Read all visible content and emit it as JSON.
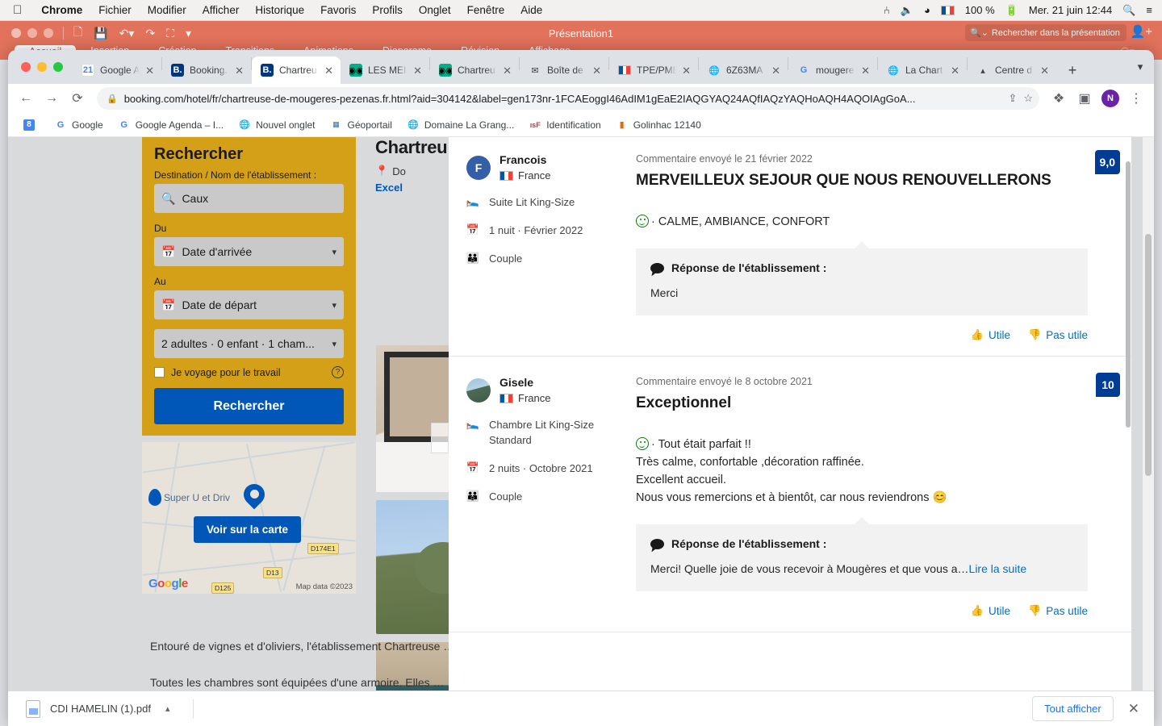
{
  "mac_menu": {
    "apple_icon": "apple-icon",
    "items": [
      "Chrome",
      "Fichier",
      "Modifier",
      "Afficher",
      "Historique",
      "Favoris",
      "Profils",
      "Onglet",
      "Fenêtre",
      "Aide"
    ],
    "status": {
      "bluetooth_icon": "bluetooth-icon",
      "volume_icon": "volume-icon",
      "wifi_icon": "wifi-icon",
      "flag_icon": "french-flag-icon",
      "battery_percent": "100 %",
      "battery_icon": "battery-charging-icon",
      "datetime": "Mer. 21 juin  12:44",
      "search_icon": "spotlight-search-icon",
      "control_center_icon": "control-center-icon"
    }
  },
  "powerpoint": {
    "title": "Présentation1",
    "quick_access": [
      "new-icon",
      "save-icon",
      "undo-icon",
      "redo-icon",
      "present-icon",
      "more-icon"
    ],
    "tabs": [
      "Accueil",
      "Insertion",
      "Création",
      "Transitions",
      "Animations",
      "Diaporama",
      "Révision",
      "Affichage"
    ],
    "active_tab": "Accueil",
    "search_placeholder": "Rechercher dans la présentation",
    "share_icon": "add-user-icon"
  },
  "chrome": {
    "tabs": [
      {
        "label": "Google A",
        "favicon": "google-calendar-icon",
        "active": false
      },
      {
        "label": "Booking.",
        "favicon": "booking-icon",
        "active": false
      },
      {
        "label": "Chartreu",
        "favicon": "booking-icon",
        "active": true
      },
      {
        "label": "LES MEI",
        "favicon": "tripadvisor-icon",
        "active": false
      },
      {
        "label": "Chartreu",
        "favicon": "tripadvisor-icon",
        "active": false
      },
      {
        "label": "Boîte de",
        "favicon": "gmail-icon",
        "active": false
      },
      {
        "label": "TPE/PME",
        "favicon": "french-flag-icon",
        "active": false
      },
      {
        "label": "6Z63MA",
        "favicon": "globe-icon",
        "active": false
      },
      {
        "label": "mougere",
        "favicon": "google-icon",
        "active": false
      },
      {
        "label": "La Chart",
        "favicon": "globe-icon",
        "active": false
      },
      {
        "label": "Centre d",
        "favicon": "squarespace-icon",
        "active": false
      }
    ],
    "new_tab_label": "+",
    "tab_list_icon": "chevron-down-icon",
    "toolbar": {
      "back_icon": "back-arrow-icon",
      "forward_icon": "forward-arrow-icon",
      "reload_icon": "reload-icon",
      "lock_icon": "lock-icon",
      "url": "booking.com/hotel/fr/chartreuse-de-mougeres-pezenas.fr.html?aid=304142&label=gen173nr-1FCAEoggI46AdIM1gEaE2IAQGYAQ24AQfIAQzYAQHoAQH4AQOIAgGoA...",
      "share_icon": "share-icon",
      "bookmark_icon": "star-icon",
      "extensions_icon": "extensions-icon",
      "sidepanel_icon": "side-panel-icon",
      "profile_initial": "N",
      "menu_icon": "three-dot-menu-icon"
    },
    "bookmarks": [
      {
        "label": "",
        "icon": "blue-8-icon"
      },
      {
        "label": "Google",
        "icon": "google-icon"
      },
      {
        "label": "Google Agenda – I...",
        "icon": "google-icon"
      },
      {
        "label": "Nouvel onglet",
        "icon": "globe-icon"
      },
      {
        "label": "Géoportail",
        "icon": "geoportail-icon"
      },
      {
        "label": "Domaine La Grang...",
        "icon": "globe-icon"
      },
      {
        "label": "Identification",
        "icon": "isf-icon"
      },
      {
        "label": "Golinhac 12140",
        "icon": "orange-book-icon"
      }
    ]
  },
  "booking_sidebar": {
    "title": "Rechercher",
    "destination_label_parts": [
      "Destination / ",
      "Nom",
      " de ",
      "l'é",
      "tablissement :"
    ],
    "destination_label": "Destination / Nom de l'établissement :",
    "destination_value": "Caux",
    "search_icon": "search-icon",
    "from_label": "Du",
    "from_placeholder": "Date d'arrivée",
    "to_label": "Au",
    "to_placeholder": "Date de départ",
    "calendar_icon": "calendar-icon",
    "chevron_icon": "chevron-down-icon",
    "occupancy_value": "2 adultes · 0 enfant · 1 cham...",
    "business_checkbox_label": "Je voyage pour le travail",
    "help_icon": "question-mark-icon",
    "search_button": "Rechercher"
  },
  "map": {
    "poi_label": "Super U et Driv",
    "poi_icon": "shopping-cart-pin-icon",
    "hotel_pin_icon": "map-pin-icon",
    "button": "Voir sur la carte",
    "attribution": "Map data ©2023",
    "logo": "Google",
    "road_badges": [
      "D174E1",
      "D13",
      "D125"
    ]
  },
  "hotel": {
    "name": "Chartreu",
    "address": "Do",
    "rating_text": "Excel",
    "location_icon": "location-pin-icon"
  },
  "description": {
    "paragraph1": "Entouré de vignes et d'oliviers, l'établissement Chartreuse … d'une piscine extérieure ouverte en saison. Certains logen…",
    "paragraph2": "Toutes les chambres sont équipées d'une armoire. Elles …"
  },
  "modal": {
    "close_icon": "close-icon",
    "reviews": [
      {
        "avatar_initial": "F",
        "avatar_type": "initial",
        "name": "Francois",
        "country": "France",
        "country_flag": "french-flag-icon",
        "room_icon": "bed-icon",
        "room": "Suite Lit King-Size",
        "stay_icon": "calendar-icon",
        "stay": "1 nuit ·  Février 2022",
        "party_icon": "couple-icon",
        "party": "Couple",
        "date": "Commentaire envoyé le 21 février 2022",
        "title": "MERVEILLEUX SEJOUR QUE NOUS RENOUVELLERONS",
        "score": "9,0",
        "positive_icon": "smiley-icon",
        "body_lines": [
          "· CALME, AMBIANCE, CONFORT"
        ],
        "owner_reply_heading": "Réponse de l'établissement :",
        "owner_reply_icon": "speech-bubble-icon",
        "owner_reply_text": "Merci",
        "owner_reply_link": "",
        "helpful_label": "Utile",
        "helpful_icon": "thumbs-up-icon",
        "not_helpful_label": "Pas utile",
        "not_helpful_icon": "thumbs-down-icon"
      },
      {
        "avatar_initial": "",
        "avatar_type": "photo",
        "name": "Gisele",
        "country": "France",
        "country_flag": "french-flag-icon",
        "room_icon": "bed-icon",
        "room": "Chambre Lit King-Size Standard",
        "stay_icon": "calendar-icon",
        "stay": "2 nuits ·  Octobre 2021",
        "party_icon": "couple-icon",
        "party": "Couple",
        "date": "Commentaire envoyé le 8 octobre 2021",
        "title": "Exceptionnel",
        "score": "10",
        "positive_icon": "smiley-icon",
        "body_lines": [
          "· Tout était parfait !!",
          "Très calme, confortable ,décoration raffinée.",
          "Excellent accueil.",
          "Nous vous remercions et à bientôt, car nous reviendrons 😊"
        ],
        "owner_reply_heading": "Réponse de l'établissement :",
        "owner_reply_icon": "speech-bubble-icon",
        "owner_reply_text": "Merci! Quelle joie de vous recevoir à Mougères et que vous a…",
        "owner_reply_link": "Lire la suite",
        "helpful_label": "Utile",
        "helpful_icon": "thumbs-up-icon",
        "not_helpful_label": "Pas utile",
        "not_helpful_icon": "thumbs-down-icon"
      }
    ]
  },
  "download_bar": {
    "file_name": "CDI HAMELIN (1).pdf",
    "file_icon": "pdf-file-icon",
    "menu_icon": "chevron-up-icon",
    "show_all_label": "Tout afficher",
    "close_icon": "close-icon"
  },
  "colors": {
    "powerpoint_accent": "#e2725b",
    "booking_blue": "#0057b8",
    "booking_dark_blue": "#003b95",
    "booking_yellow": "#d4a017",
    "link_blue": "#0071c2"
  }
}
